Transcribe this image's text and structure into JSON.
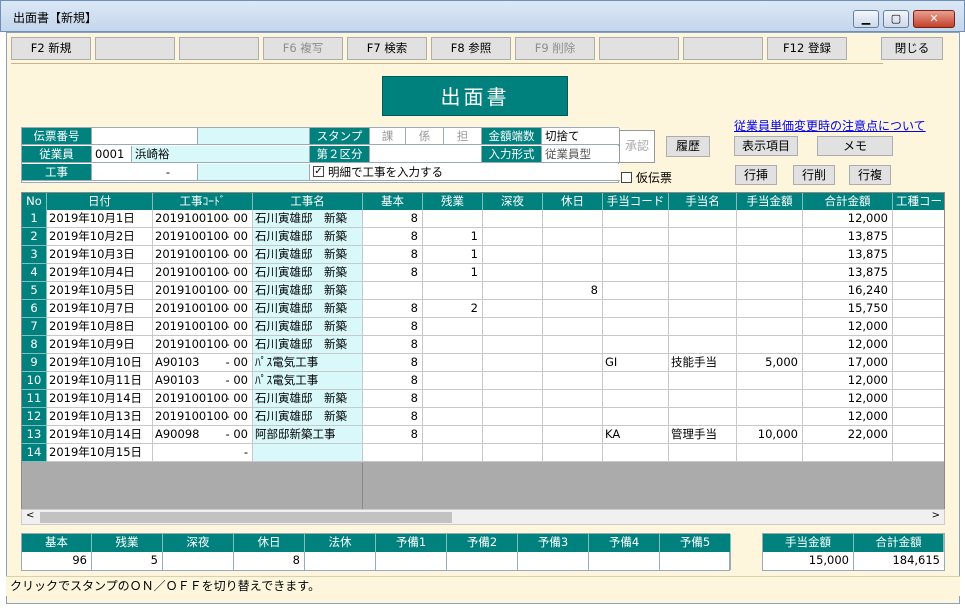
{
  "window": {
    "title": "出面書【新規】",
    "minimize": "▁",
    "maximize": "▢",
    "close": "✕"
  },
  "toolbar": {
    "f2": "F2 新規",
    "f6": "F6 複写",
    "f7": "F7 検索",
    "f8": "F8 参照",
    "f9": "F9 削除",
    "f12": "F12 登録",
    "close": "閉じる"
  },
  "heading": "出面書",
  "header": {
    "slip_no_label": "伝票番号",
    "slip_no": "",
    "employee_label": "従業員",
    "employee_code": "0001",
    "employee_name": "浜崎裕",
    "work_label": "工事",
    "work_value": "-",
    "stamp_label": "スタンプ",
    "stamp1": "課",
    "stamp2": "係",
    "stamp3": "担",
    "kubun_label": "第２区分",
    "kubun_value": "",
    "rounding_label": "金額端数",
    "rounding_value": "切捨て",
    "input_type_label": "入力形式",
    "input_type_value": "従業員型",
    "detail_checkbox": "明細で工事を入力する",
    "temp_slip_checkbox": "仮伝票",
    "approve": "承認",
    "history": "履歴"
  },
  "side": {
    "notice_link": "従業員単価変更時の注意点について",
    "display_items": "表示項目",
    "memo": "メモ",
    "row_insert": "行挿",
    "row_delete": "行削",
    "row_copy": "行複"
  },
  "grid": {
    "columns": [
      "No",
      "日付",
      "工事ｺｰﾄﾞ",
      "工事名",
      "基本",
      "残業",
      "深夜",
      "休日",
      "手当コード",
      "手当名",
      "手当金額",
      "合計金額",
      "工種コー"
    ],
    "rows": [
      {
        "no": "1",
        "date": "2019年10月1日",
        "code": "2019100100",
        "sub": "- 00",
        "name": "石川寅雄邸　新築",
        "basic": "8",
        "over": "",
        "night": "",
        "holiday": "",
        "acode": "",
        "aname": "",
        "aamount": "",
        "total": "12,000"
      },
      {
        "no": "2",
        "date": "2019年10月2日",
        "code": "2019100100",
        "sub": "- 00",
        "name": "石川寅雄邸　新築",
        "basic": "8",
        "over": "1",
        "night": "",
        "holiday": "",
        "acode": "",
        "aname": "",
        "aamount": "",
        "total": "13,875"
      },
      {
        "no": "3",
        "date": "2019年10月3日",
        "code": "2019100100",
        "sub": "- 00",
        "name": "石川寅雄邸　新築",
        "basic": "8",
        "over": "1",
        "night": "",
        "holiday": "",
        "acode": "",
        "aname": "",
        "aamount": "",
        "total": "13,875"
      },
      {
        "no": "4",
        "date": "2019年10月4日",
        "code": "2019100100",
        "sub": "- 00",
        "name": "石川寅雄邸　新築",
        "basic": "8",
        "over": "1",
        "night": "",
        "holiday": "",
        "acode": "",
        "aname": "",
        "aamount": "",
        "total": "13,875"
      },
      {
        "no": "5",
        "date": "2019年10月5日",
        "code": "2019100100",
        "sub": "- 00",
        "name": "石川寅雄邸　新築",
        "basic": "",
        "over": "",
        "night": "",
        "holiday": "8",
        "acode": "",
        "aname": "",
        "aamount": "",
        "total": "16,240"
      },
      {
        "no": "6",
        "date": "2019年10月7日",
        "code": "2019100100",
        "sub": "- 00",
        "name": "石川寅雄邸　新築",
        "basic": "8",
        "over": "2",
        "night": "",
        "holiday": "",
        "acode": "",
        "aname": "",
        "aamount": "",
        "total": "15,750"
      },
      {
        "no": "7",
        "date": "2019年10月8日",
        "code": "2019100100",
        "sub": "- 00",
        "name": "石川寅雄邸　新築",
        "basic": "8",
        "over": "",
        "night": "",
        "holiday": "",
        "acode": "",
        "aname": "",
        "aamount": "",
        "total": "12,000"
      },
      {
        "no": "8",
        "date": "2019年10月9日",
        "code": "2019100100",
        "sub": "- 00",
        "name": "石川寅雄邸　新築",
        "basic": "8",
        "over": "",
        "night": "",
        "holiday": "",
        "acode": "",
        "aname": "",
        "aamount": "",
        "total": "12,000"
      },
      {
        "no": "9",
        "date": "2019年10月10日",
        "code": "A90103",
        "sub": "- 00",
        "name": "ﾊﾟｽ電気工事",
        "basic": "8",
        "over": "",
        "night": "",
        "holiday": "",
        "acode": "GI",
        "aname": "技能手当",
        "aamount": "5,000",
        "total": "17,000"
      },
      {
        "no": "10",
        "date": "2019年10月11日",
        "code": "A90103",
        "sub": "- 00",
        "name": "ﾊﾟｽ電気工事",
        "basic": "8",
        "over": "",
        "night": "",
        "holiday": "",
        "acode": "",
        "aname": "",
        "aamount": "",
        "total": "12,000"
      },
      {
        "no": "11",
        "date": "2019年10月14日",
        "code": "2019100100",
        "sub": "- 00",
        "name": "石川寅雄邸　新築",
        "basic": "8",
        "over": "",
        "night": "",
        "holiday": "",
        "acode": "",
        "aname": "",
        "aamount": "",
        "total": "12,000"
      },
      {
        "no": "12",
        "date": "2019年10月13日",
        "code": "2019100100",
        "sub": "- 00",
        "name": "石川寅雄邸　新築",
        "basic": "8",
        "over": "",
        "night": "",
        "holiday": "",
        "acode": "",
        "aname": "",
        "aamount": "",
        "total": "12,000"
      },
      {
        "no": "13",
        "date": "2019年10月14日",
        "code": "A90098",
        "sub": "- 00",
        "name": "阿部邸新築工事",
        "basic": "8",
        "over": "",
        "night": "",
        "holiday": "",
        "acode": "KA",
        "aname": "管理手当",
        "aamount": "10,000",
        "total": "22,000"
      },
      {
        "no": "14",
        "date": "2019年10月15日",
        "code": "",
        "sub": "-",
        "name": "",
        "basic": "",
        "over": "",
        "night": "",
        "holiday": "",
        "acode": "",
        "aname": "",
        "aamount": "",
        "total": ""
      }
    ]
  },
  "totals": {
    "labels": [
      "基本",
      "残業",
      "深夜",
      "休日",
      "法休",
      "予備1",
      "予備2",
      "予備3",
      "予備4",
      "予備5"
    ],
    "values": [
      "96",
      "5",
      "",
      "8",
      "",
      "",
      "",
      "",
      "",
      ""
    ],
    "allowance_label": "手当金額",
    "allowance_value": "15,000",
    "total_label": "合計金額",
    "total_value": "184,615"
  },
  "status": "クリックでスタンプのＯＮ／ＯＦＦを切り替えできます。"
}
